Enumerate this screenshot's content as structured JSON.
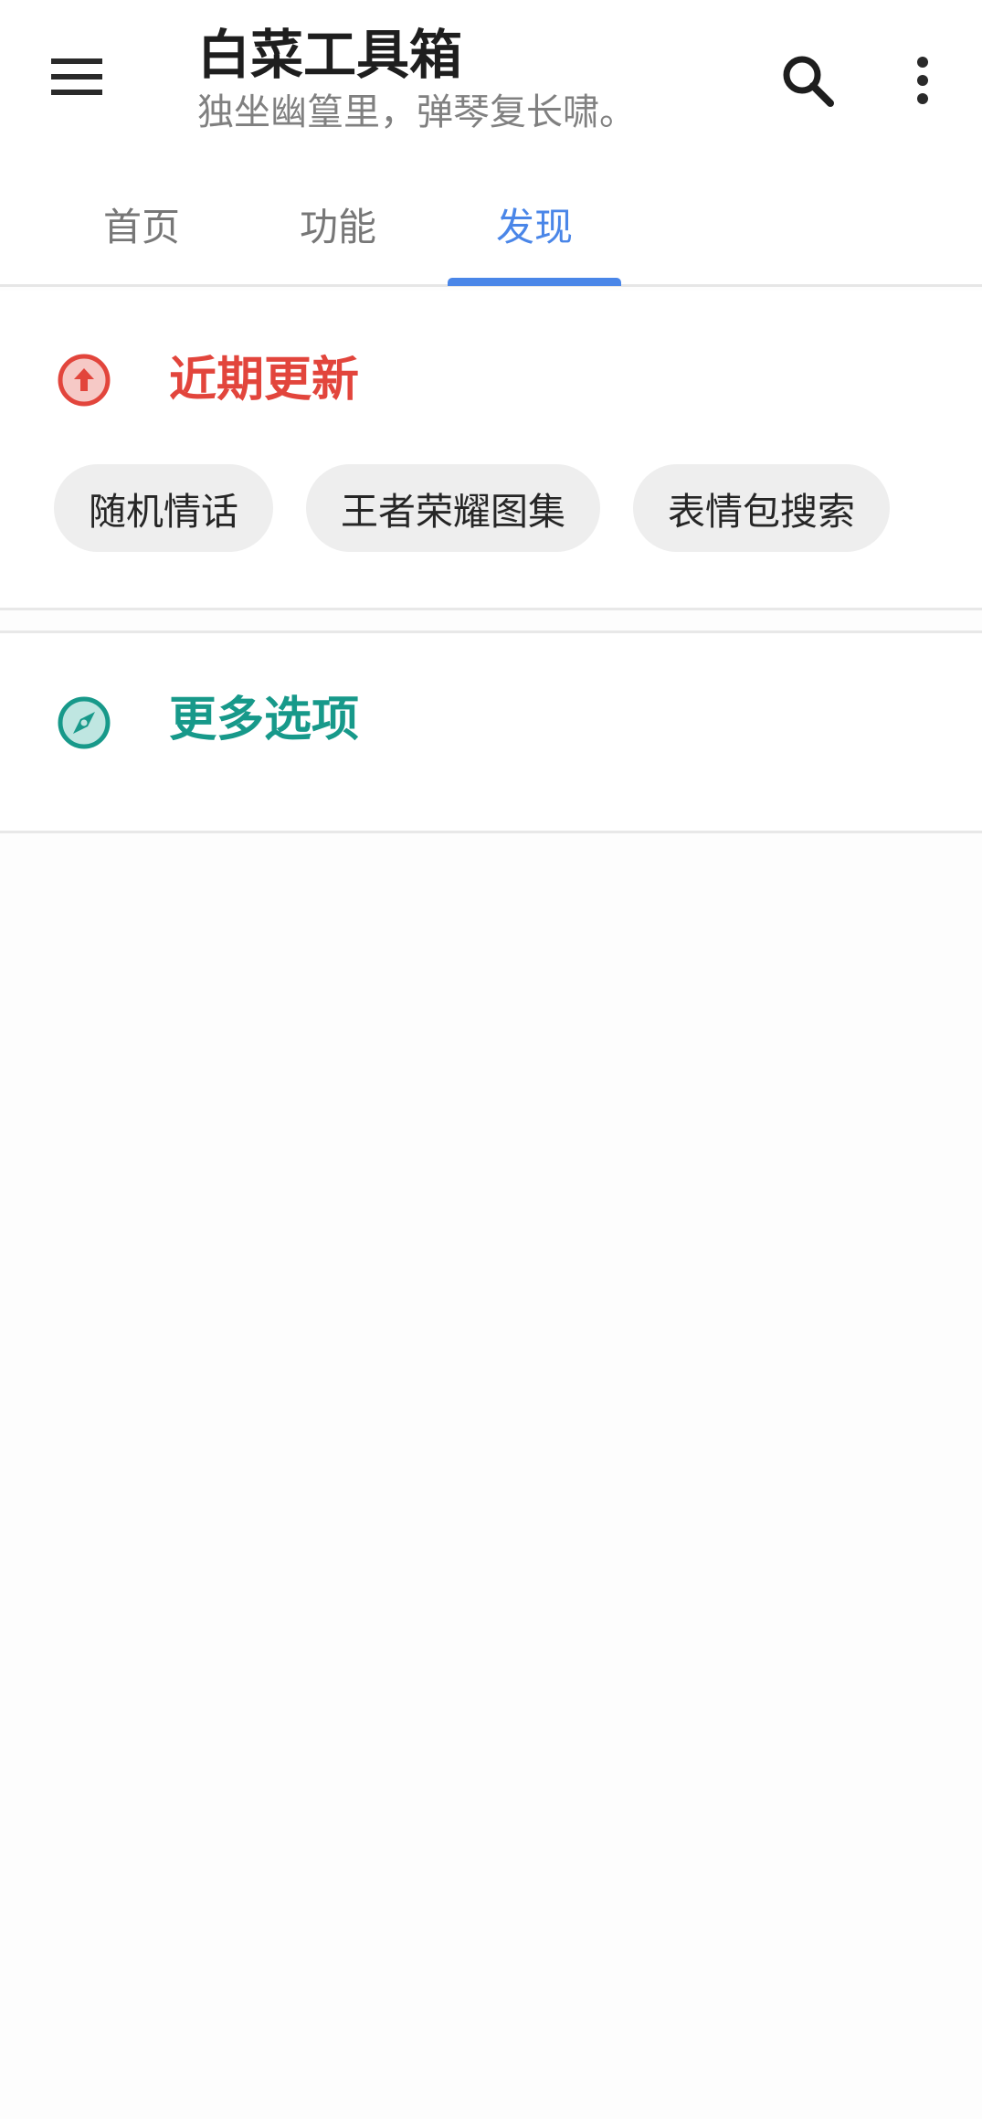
{
  "appbar": {
    "title": "白菜工具箱",
    "subtitle": "独坐幽篁里，弹琴复长啸。",
    "menu_icon": "menu-icon",
    "search_icon": "search-icon",
    "more_icon": "more-vert-icon"
  },
  "tabs": [
    {
      "label": "首页",
      "active": false
    },
    {
      "label": "功能",
      "active": false
    },
    {
      "label": "发现",
      "active": true
    }
  ],
  "sections": {
    "recent": {
      "title": "近期更新",
      "icon": "arrow-up-circle-icon",
      "color": "#e2453c",
      "chips": [
        "随机情话",
        "王者荣耀图集",
        "表情包搜索"
      ]
    },
    "more": {
      "title": "更多选项",
      "icon": "compass-icon",
      "color": "#17998a"
    }
  },
  "colors": {
    "accent": "#4a86e8",
    "chip_bg": "#eeeeee"
  }
}
